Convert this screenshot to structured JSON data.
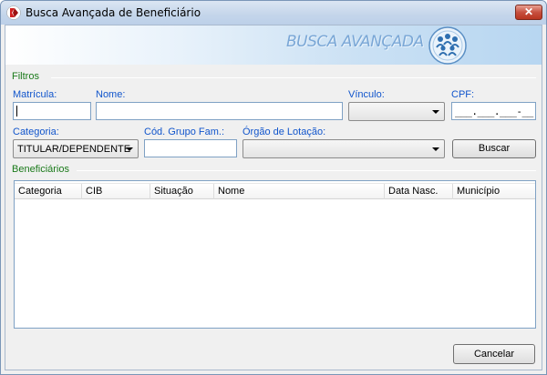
{
  "window": {
    "title": "Busca Avançada de Beneficiário",
    "close_glyph": "✕"
  },
  "banner": {
    "text": "BUSCA AVANÇADA",
    "logo_icon": "people-group-logo"
  },
  "filters": {
    "group_label": "Filtros",
    "matricula": {
      "label": "Matrícula:",
      "value": ""
    },
    "nome": {
      "label": "Nome:",
      "value": ""
    },
    "vinculo": {
      "label": "Vínculo:",
      "value": ""
    },
    "cpf": {
      "label": "CPF:",
      "mask": "___.___.___-__"
    },
    "categoria": {
      "label": "Categoria:",
      "value": "TITULAR/DEPENDENTE"
    },
    "cod_grupo": {
      "label": "Cód. Grupo Fam.:",
      "value": ""
    },
    "orgao": {
      "label": "Órgão de Lotação:",
      "value": ""
    },
    "search_button": "Buscar"
  },
  "results": {
    "group_label": "Beneficiários",
    "columns": [
      "Categoria",
      "CIB",
      "Situação",
      "Nome",
      "Data Nasc.",
      "Município"
    ],
    "rows": []
  },
  "footer": {
    "cancel_button": "Cancelar"
  },
  "colors": {
    "label_blue": "#1155cc",
    "group_green": "#1a7a1a",
    "close_red": "#c7503f"
  }
}
